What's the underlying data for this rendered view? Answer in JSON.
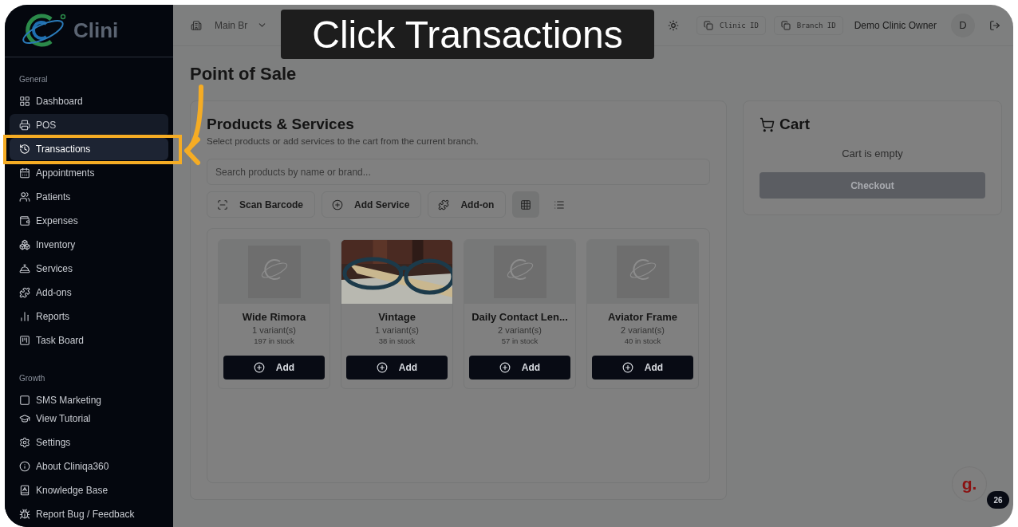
{
  "callout": {
    "text": "Click Transactions"
  },
  "logo": {
    "text": "Clini"
  },
  "sidebar": {
    "sections": [
      {
        "title": "General",
        "items": [
          {
            "label": "Dashboard",
            "kind": "dashboard",
            "selected": false,
            "hovered": false
          },
          {
            "label": "POS",
            "kind": "pos",
            "selected": true,
            "hovered": false
          },
          {
            "label": "Transactions",
            "kind": "history",
            "selected": false,
            "hovered": true
          },
          {
            "label": "Appointments",
            "kind": "calendar",
            "selected": false,
            "hovered": false
          },
          {
            "label": "Patients",
            "kind": "users",
            "selected": false,
            "hovered": false
          },
          {
            "label": "Expenses",
            "kind": "wallet",
            "selected": false,
            "hovered": false
          },
          {
            "label": "Inventory",
            "kind": "boxes",
            "selected": false,
            "hovered": false
          },
          {
            "label": "Services",
            "kind": "bell",
            "selected": false,
            "hovered": false
          },
          {
            "label": "Add-ons",
            "kind": "puzzle",
            "selected": false,
            "hovered": false
          },
          {
            "label": "Reports",
            "kind": "chart",
            "selected": false,
            "hovered": false
          },
          {
            "label": "Task Board",
            "kind": "kanban",
            "selected": false,
            "hovered": false
          }
        ]
      },
      {
        "title": "Growth",
        "items": [
          {
            "label": "SMS Marketing",
            "kind": "square",
            "selected": false,
            "hovered": false
          }
        ]
      }
    ],
    "footer": [
      {
        "label": "View Tutorial",
        "kind": "cap"
      },
      {
        "label": "Settings",
        "kind": "settings"
      },
      {
        "label": "About Cliniqa360",
        "kind": "info"
      },
      {
        "label": "Knowledge Base",
        "kind": "book"
      },
      {
        "label": "Report Bug / Feedback",
        "kind": "bug"
      }
    ]
  },
  "header": {
    "branch": "Main Br",
    "chips": [
      "Clinic ID",
      "Branch ID"
    ],
    "user": "Demo Clinic Owner",
    "avatar": "D"
  },
  "page": {
    "title": "Point of Sale"
  },
  "products": {
    "title": "Products & Services",
    "subtitle": "Select products or add services to the cart from the current branch.",
    "search": {
      "placeholder": "Search products by name or brand..."
    },
    "actions": [
      {
        "label": "Scan Barcode",
        "kind": "scan"
      },
      {
        "label": "Add Service",
        "kind": "plus"
      },
      {
        "label": "Add-on",
        "kind": "puzzle"
      }
    ],
    "views": [
      {
        "kind": "grid",
        "selected": true
      },
      {
        "kind": "list",
        "selected": false
      }
    ],
    "items": [
      {
        "name": "Wide Rimora",
        "variants": "1 variant(s)",
        "stock": "197 in stock",
        "kind": "placeholder",
        "button": "Add"
      },
      {
        "name": "Vintage",
        "variants": "1 variant(s)",
        "stock": "38 in stock",
        "kind": "picture",
        "button": "Add"
      },
      {
        "name": "Daily Contact Len...",
        "variants": "2 variant(s)",
        "stock": "57 in stock",
        "kind": "placeholder",
        "button": "Add"
      },
      {
        "name": "Aviator Frame",
        "variants": "2 variant(s)",
        "stock": "40 in stock",
        "kind": "placeholder",
        "button": "Add"
      }
    ]
  },
  "cart": {
    "title": "Cart",
    "empty": "Cart is empty",
    "checkout": {
      "label": "Checkout",
      "disabled": true
    }
  },
  "widget": {
    "logo": "g.",
    "badge": "26"
  }
}
